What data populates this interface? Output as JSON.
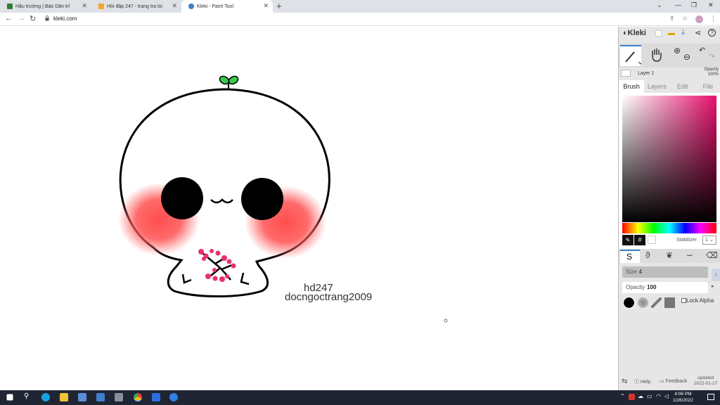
{
  "browser": {
    "tabs": [
      {
        "title": "Hậu trường | Báo Dân trí",
        "active": false
      },
      {
        "title": "Hỏi đáp 247 - trang tra loi",
        "active": false
      },
      {
        "title": "Kleki - Paint Tool",
        "active": true
      }
    ],
    "new_tab_icon": "plus-icon",
    "url": "kleki.com"
  },
  "canvas": {
    "signature_line1": "hd247",
    "signature_line2": "docngoctrang2009"
  },
  "panel": {
    "logo": "Kleki",
    "layer_name": "Layer 1",
    "opacity_label": "Opacity",
    "opacity_value": "100%",
    "tabs": [
      "Brush",
      "Layers",
      "Edit",
      "File"
    ],
    "active_tab": "Brush",
    "hex_label": "#",
    "stabilizer_label": "Stabilizer",
    "stabilizer_value": "1",
    "size_label": "Size",
    "size_value": "4",
    "brush_opacity_label": "Opacity",
    "brush_opacity_value": "100",
    "lock_alpha_label": "Lock Alpha",
    "help_label": "Help",
    "feedback_label": "Feedback",
    "updated_label": "updated",
    "updated_date": "2022-01-17",
    "colors": {
      "primary": "#e8106d",
      "accent": "#3d7fc9"
    }
  },
  "taskbar": {
    "time": "4:06 PM",
    "date": "1/26/2022"
  }
}
